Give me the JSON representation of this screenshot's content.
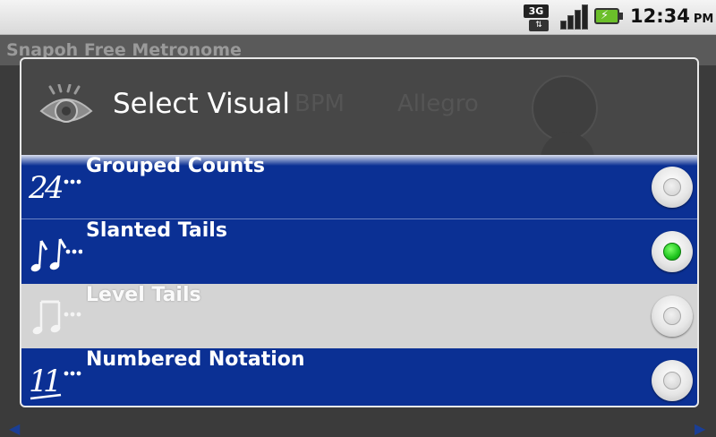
{
  "status_bar": {
    "network": "3G",
    "time": "12:34",
    "ampm": "PM"
  },
  "background_app": {
    "title": "Snapoh Free Metronome",
    "tempo_label": "BPM",
    "tempo_name": "Allegro"
  },
  "dialog": {
    "title": "Select Visual",
    "title_icon": "eye-icon",
    "options": [
      {
        "label": "Grouped Counts",
        "icon": "grouped-counts-icon",
        "selected": false,
        "highlighted": false
      },
      {
        "label": "Slanted Tails",
        "icon": "slanted-tails-icon",
        "selected": true,
        "highlighted": false
      },
      {
        "label": "Level Tails",
        "icon": "level-tails-icon",
        "selected": false,
        "highlighted": true
      },
      {
        "label": "Numbered Notation",
        "icon": "numbered-notation-icon",
        "selected": false,
        "highlighted": false
      }
    ]
  },
  "colors": {
    "option_bg": "#0b3094",
    "highlight_bg": "#d4d4d4",
    "radio_checked": "#1ec51e",
    "header_bg": "#474747"
  }
}
